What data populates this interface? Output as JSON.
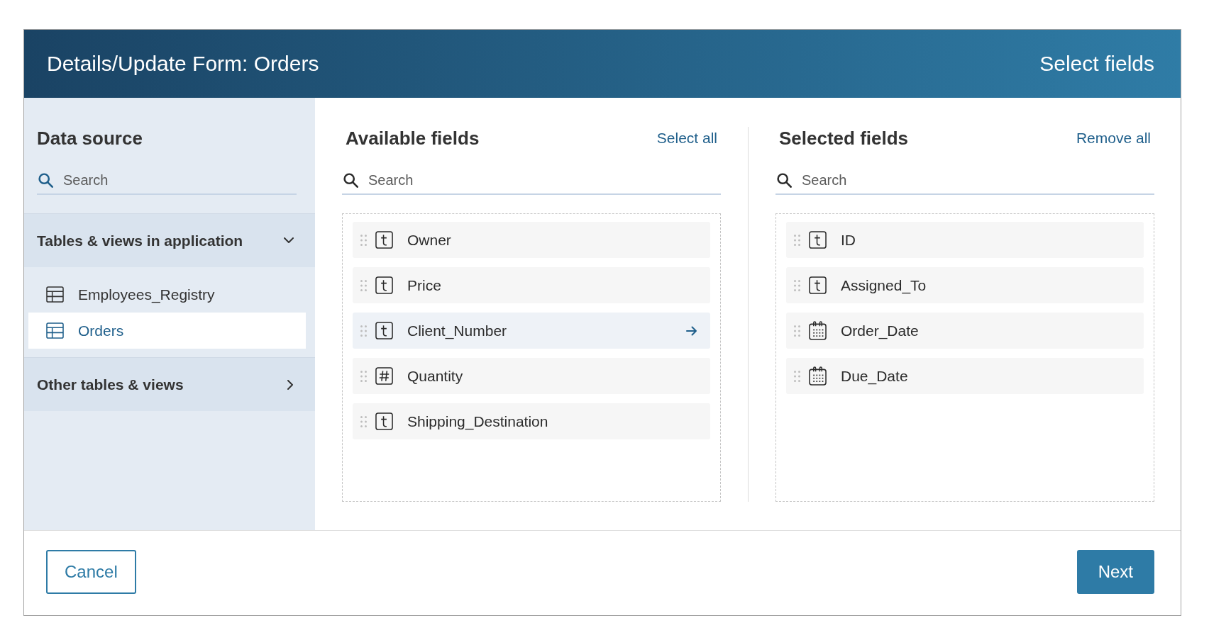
{
  "dialog": {
    "title": "Details/Update Form: Orders",
    "step": "Select fields"
  },
  "data_source": {
    "heading": "Data source",
    "search": {
      "placeholder": "Search"
    },
    "groups": [
      {
        "label": "Tables & views in application",
        "expanded": true,
        "items": [
          {
            "label": "Employees_Registry",
            "selected": false
          },
          {
            "label": "Orders",
            "selected": true
          }
        ]
      },
      {
        "label": "Other tables & views",
        "expanded": false
      }
    ]
  },
  "available_fields": {
    "heading": "Available fields",
    "action": "Select all",
    "search": {
      "placeholder": "Search"
    },
    "fields": [
      {
        "name": "Owner",
        "kind": "text",
        "highlighted": false
      },
      {
        "name": "Price",
        "kind": "text",
        "highlighted": false
      },
      {
        "name": "Client_Number",
        "kind": "text",
        "highlighted": true
      },
      {
        "name": "Quantity",
        "kind": "number",
        "highlighted": false
      },
      {
        "name": "Shipping_Destination",
        "kind": "text",
        "highlighted": false
      }
    ]
  },
  "selected_fields": {
    "heading": "Selected fields",
    "action": "Remove all",
    "search": {
      "placeholder": "Search"
    },
    "fields": [
      {
        "name": "ID",
        "kind": "text",
        "highlighted": false
      },
      {
        "name": "Assigned_To",
        "kind": "text",
        "highlighted": false
      },
      {
        "name": "Order_Date",
        "kind": "date",
        "highlighted": false
      },
      {
        "name": "Due_Date",
        "kind": "date",
        "highlighted": false
      }
    ]
  },
  "buttons": [
    {
      "label": "Cancel",
      "kind": "secondary"
    },
    {
      "label": "Next",
      "kind": "primary"
    }
  ]
}
